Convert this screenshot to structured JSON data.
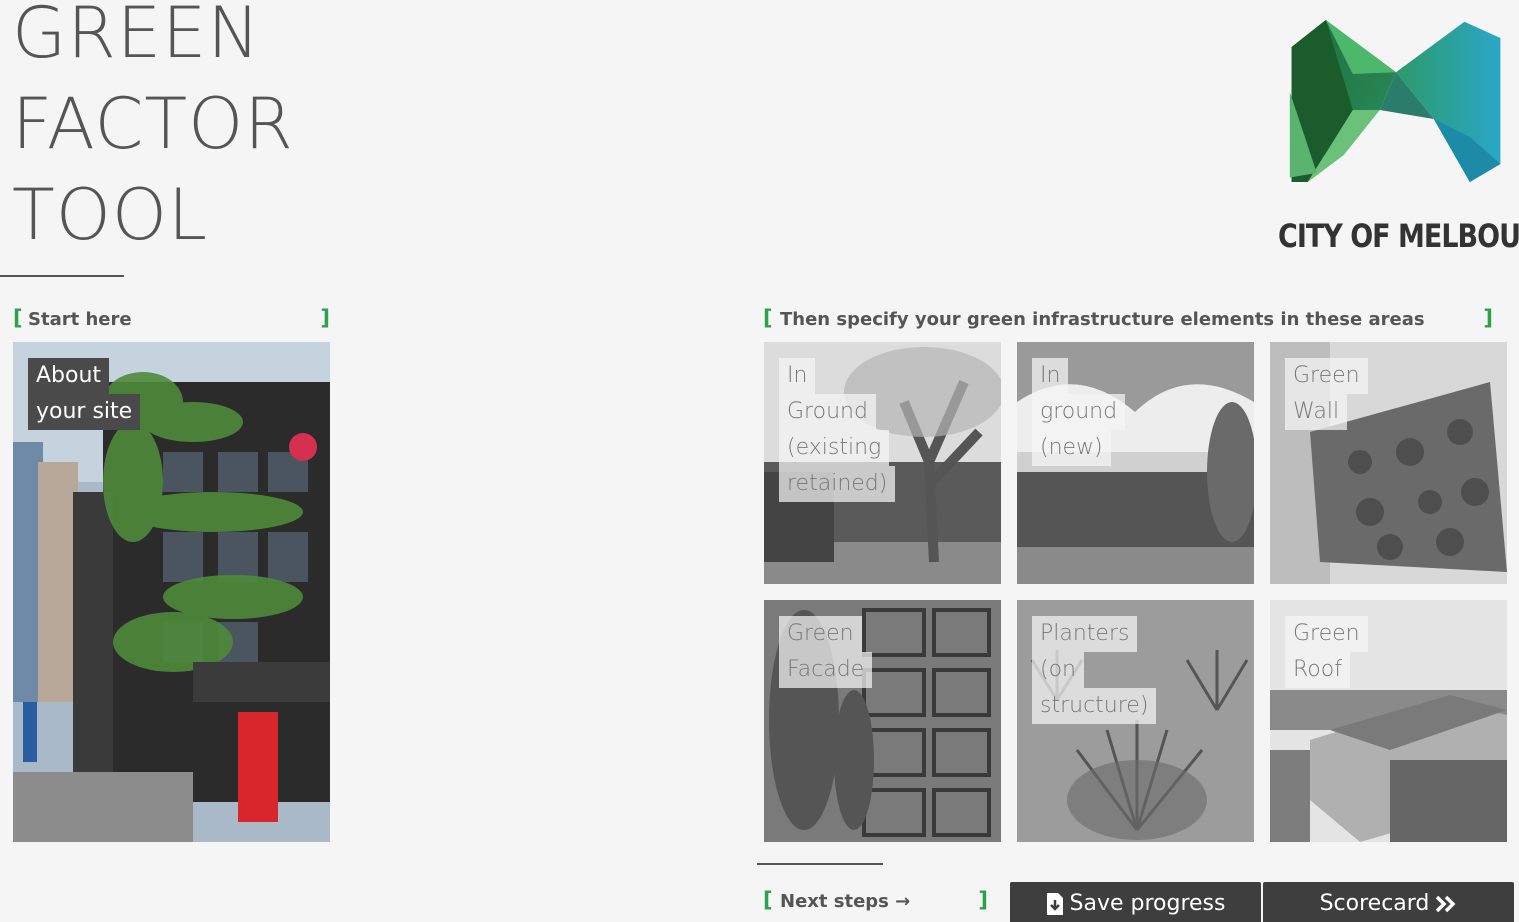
{
  "title": {
    "line1": "GREEN",
    "line2": "FACTOR",
    "line3": "TOOL"
  },
  "logo": {
    "text": "CITY OF MELBOURNE"
  },
  "start_section": {
    "label": "Start here",
    "bracket_open": "[",
    "bracket_close": "]"
  },
  "about_tile": {
    "line1": "About",
    "line2": "your site"
  },
  "areas_section": {
    "label": "Then specify your green infrastructure elements in these areas",
    "bracket_open": "[",
    "bracket_close": "]"
  },
  "areas": [
    {
      "lines": [
        "In",
        "Ground",
        "(existing",
        "retained)"
      ],
      "icon": "tree-photo"
    },
    {
      "lines": [
        "In",
        "ground",
        "(new)"
      ],
      "icon": "building-photo"
    },
    {
      "lines": [
        "Green",
        "Wall"
      ],
      "icon": "green-wall-photo"
    },
    {
      "lines": [
        "Green",
        "Facade"
      ],
      "icon": "facade-photo"
    },
    {
      "lines": [
        "Planters",
        "(on",
        "structure)"
      ],
      "icon": "planters-photo"
    },
    {
      "lines": [
        "Green",
        "Roof"
      ],
      "icon": "roof-photo"
    }
  ],
  "next_section": {
    "label": "Next steps →",
    "bracket_open": "[",
    "bracket_close": "]"
  },
  "buttons": {
    "save": "Save progress",
    "scorecard": "Scorecard"
  },
  "colors": {
    "accent_green": "#2ca24f",
    "text_gray": "#555555",
    "button_bg": "#3e3e3e",
    "background": "#f5f5f5"
  }
}
